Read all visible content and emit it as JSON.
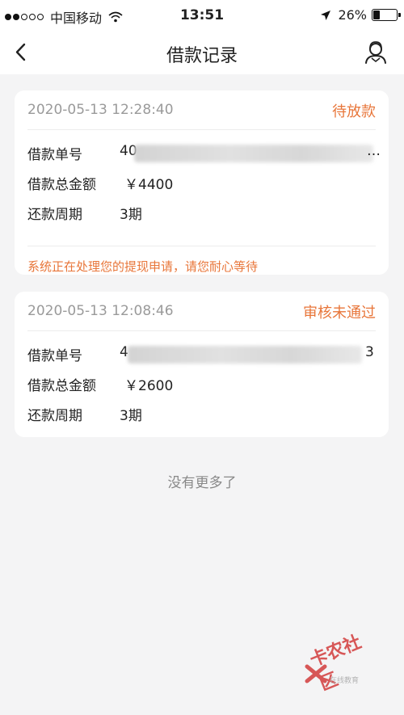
{
  "status_bar": {
    "carrier": "中国移动",
    "time": "13:51",
    "battery": "26%",
    "battery_level": 0.26
  },
  "nav": {
    "title": "借款记录",
    "back_icon": "chevron-left-icon",
    "service_icon": "customer-service-icon"
  },
  "records": [
    {
      "datetime": "2020-05-13 12:28:40",
      "status": "待放款",
      "order_label": "借款单号",
      "order_value_prefix": "40",
      "order_value_suffix": "…",
      "amount_label": "借款总金额",
      "amount_value": "￥4400",
      "period_label": "还款周期",
      "period_value": "3期",
      "notice": "系统正在处理您的提现申请，请您耐心等待"
    },
    {
      "datetime": "2020-05-13 12:08:46",
      "status": "审核未通过",
      "order_label": "借款单号",
      "order_value_prefix": "4",
      "order_value_suffix": "3",
      "amount_label": "借款总金额",
      "amount_value": "￥2600",
      "period_label": "还款周期",
      "period_value": "3期"
    }
  ],
  "footer": {
    "no_more": "没有更多了"
  },
  "watermark": {
    "text": "卡农社区",
    "sub": "在线教育"
  },
  "colors": {
    "accent": "#e8763a",
    "background": "#f4f4f5"
  }
}
